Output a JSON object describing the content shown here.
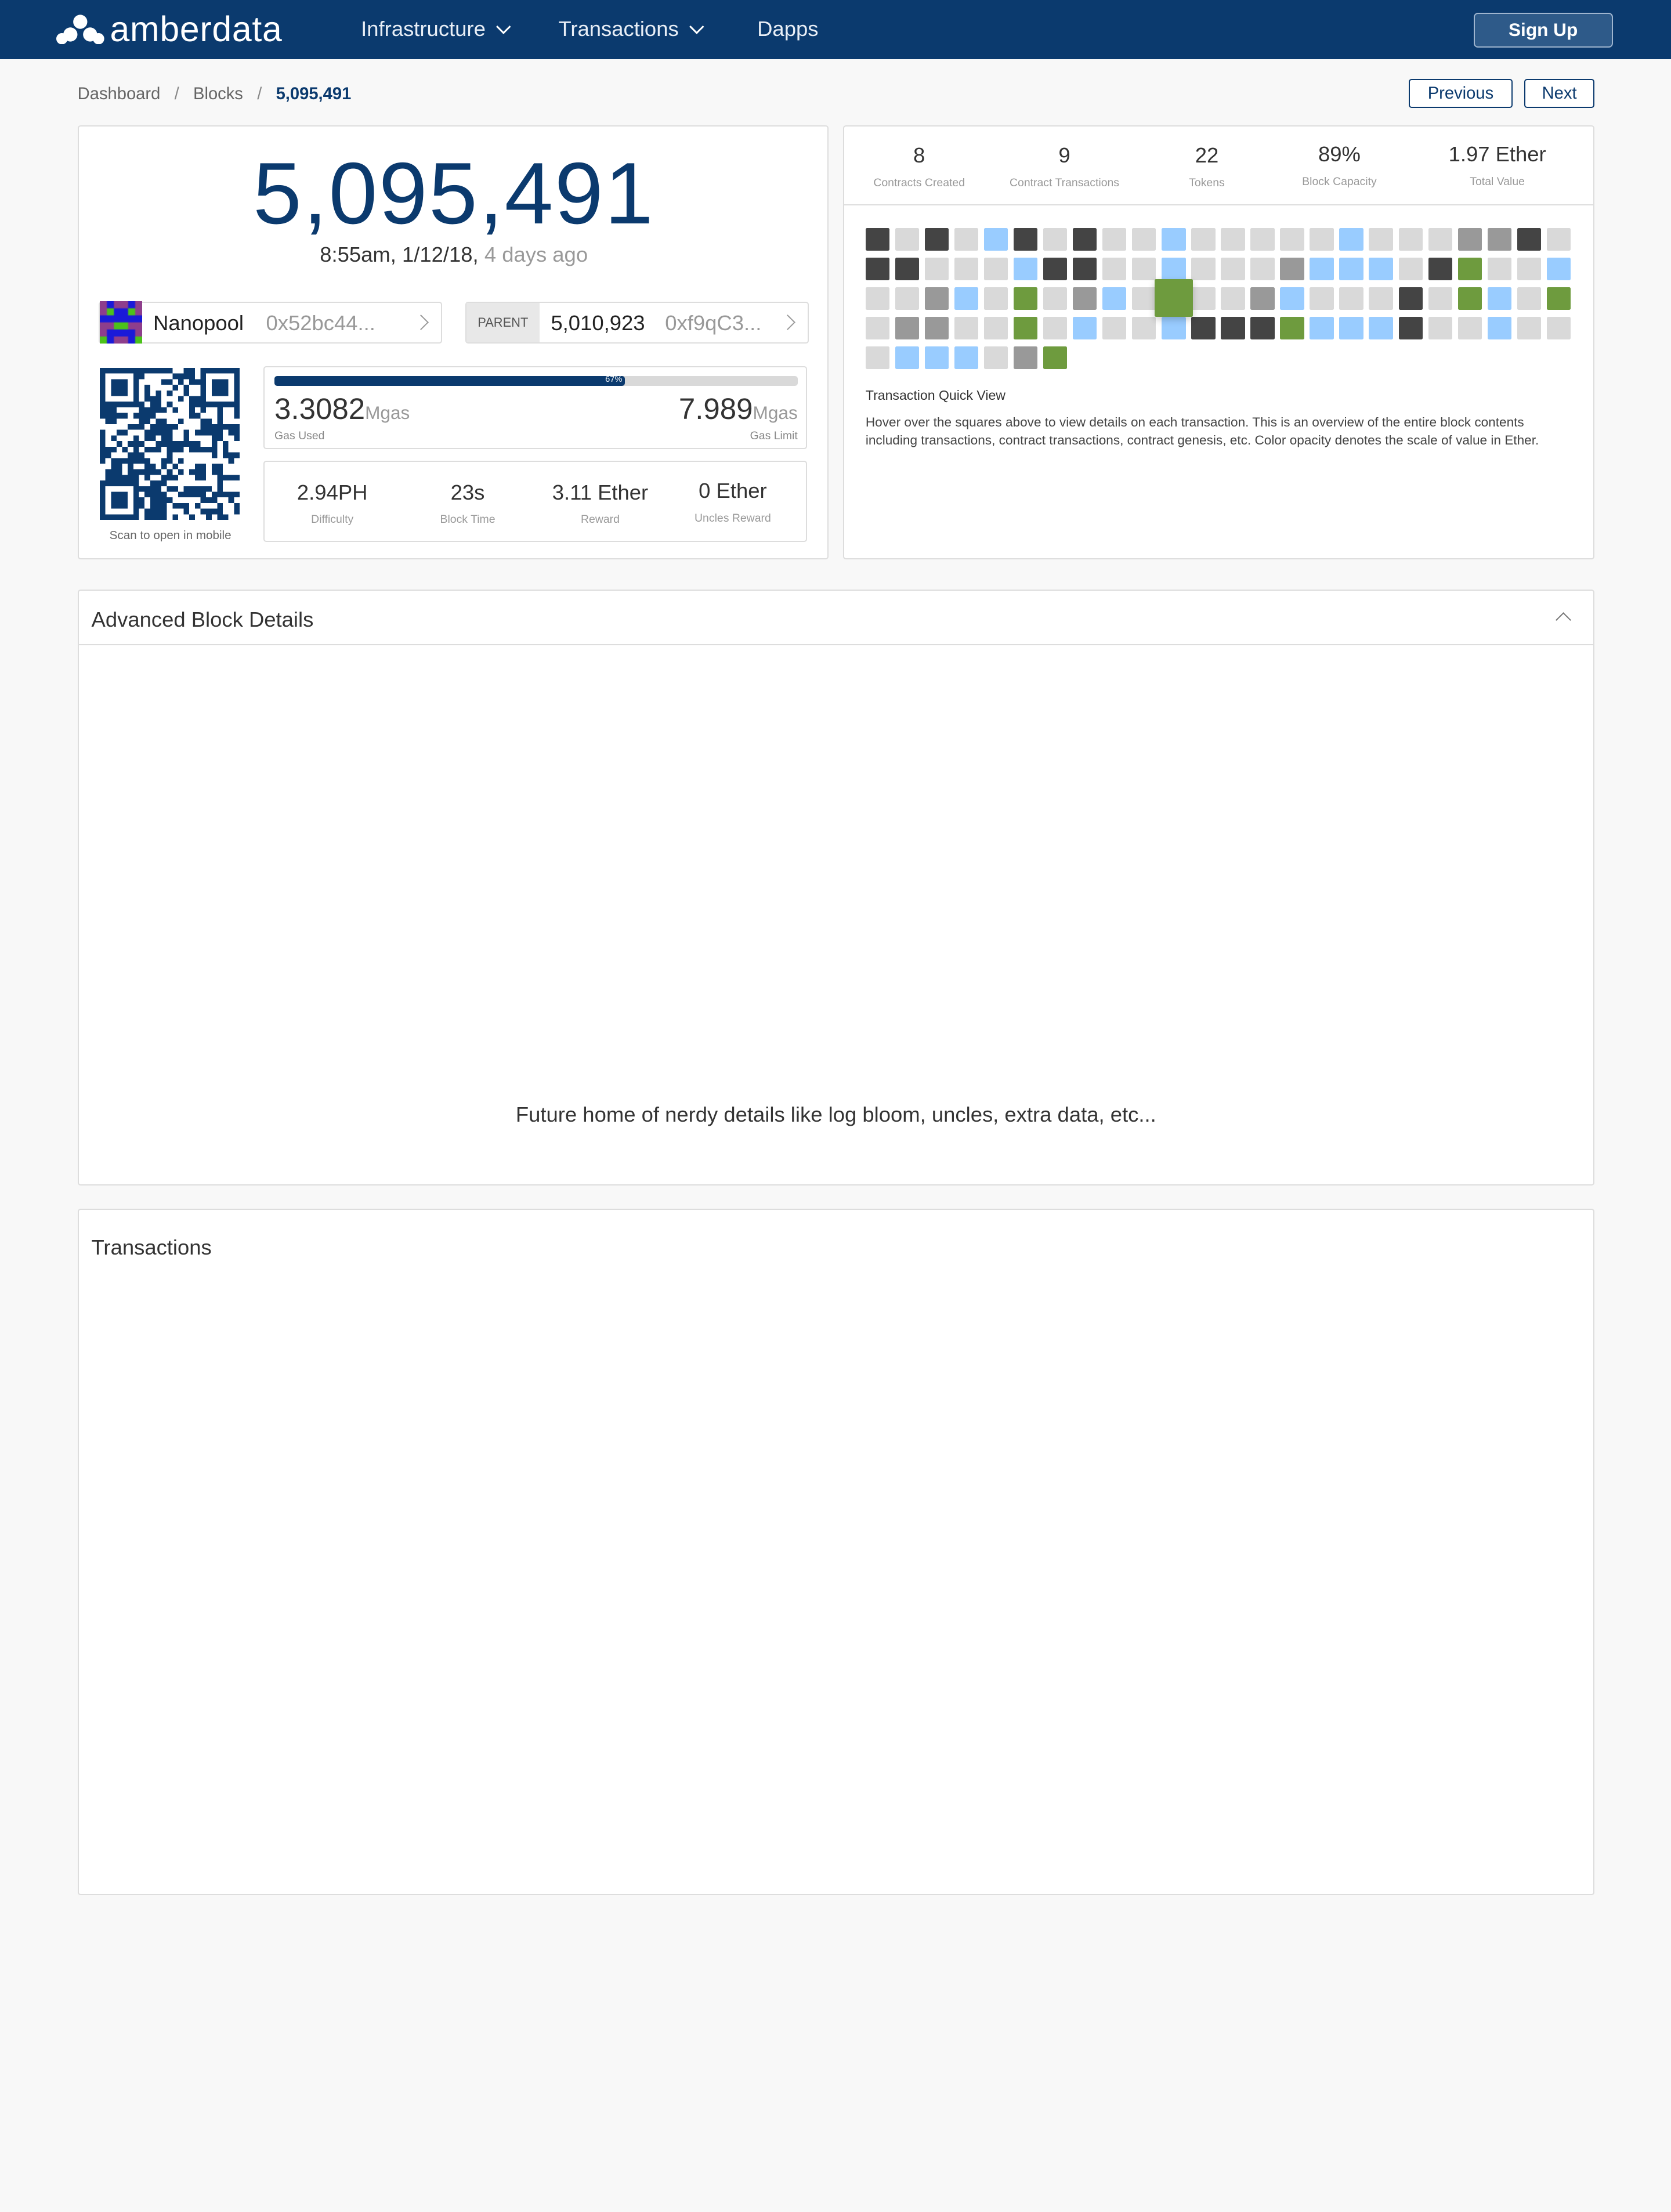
{
  "nav": {
    "brand": "amberdata",
    "items": [
      {
        "label": "Infrastructure",
        "dropdown": true
      },
      {
        "label": "Transactions",
        "dropdown": true
      },
      {
        "label": "Dapps",
        "dropdown": false
      }
    ],
    "signup": "Sign Up"
  },
  "breadcrumb": {
    "items": [
      "Dashboard",
      "Blocks"
    ],
    "current": "5,095,491"
  },
  "pager": {
    "previous": "Previous",
    "next": "Next"
  },
  "block": {
    "number": "5,095,491",
    "time": "8:55am, 1/12/18,",
    "ago": "4 days ago",
    "miner": {
      "name": "Nanopool",
      "hash": "0x52bc44..."
    },
    "parent": {
      "label": "PARENT",
      "number": "5,010,923",
      "hash": "0xf9qC3..."
    },
    "qr_caption": "Scan to open in mobile",
    "gas": {
      "percent_label": "67%",
      "percent": 67,
      "used": "3.3082",
      "used_unit": "Mgas",
      "used_label": "Gas Used",
      "limit": "7.989",
      "limit_unit": "Mgas",
      "limit_label": "Gas Limit"
    },
    "stats": [
      {
        "value": "2.94PH",
        "label": "Difficulty"
      },
      {
        "value": "23s",
        "label": "Block Time"
      },
      {
        "value": "3.11 Ether",
        "label": "Reward"
      },
      {
        "value": "0 Ether",
        "label": "Uncles Reward"
      }
    ]
  },
  "summary": [
    {
      "value": "8",
      "label": "Contracts Created"
    },
    {
      "value": "9",
      "label": "Contract Transactions"
    },
    {
      "value": "22",
      "label": "Tokens"
    },
    {
      "value": "89%",
      "label": "Block Capacity"
    },
    {
      "value": "1.97 Ether",
      "label": "Total Value"
    }
  ],
  "quickview": {
    "title": "Transaction Quick View",
    "description": "Hover over the squares above to view details on each transaction. This is an overview of the entire block contents including transactions, contract transactions, contract genesis, etc. Color opacity denotes the scale of value in Ether.",
    "colors": {
      "D": "#444444",
      "L": "#d9d9d9",
      "B": "#99ccff",
      "M": "#999999",
      "G": "#6e9b3e"
    },
    "rows": [
      "DLDLBDLDLLBLLLLLBLLLMMDL",
      "DDLLLBDDLLBLLLMBBBLDGLLB",
      "LLMBLGLMBLGLLMBLLLDLGBLG",
      "LMMLLGLBLLBDDDGBBBDLLBLL",
      "LBBBLMG"
    ],
    "hovered": {
      "row": 2,
      "col": 10
    }
  },
  "advanced": {
    "title": "Advanced Block Details",
    "body": "Future home of nerdy details like log bloom, uncles, extra data, etc..."
  },
  "transactions": {
    "title": "Transactions"
  },
  "colors": {
    "brand": "#0b3a6e"
  }
}
